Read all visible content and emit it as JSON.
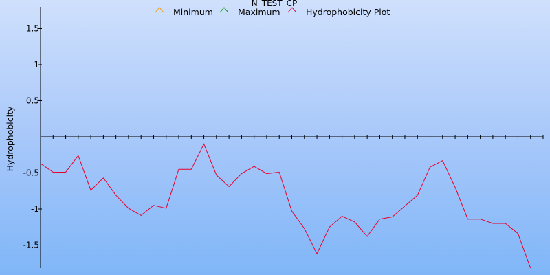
{
  "chart_data": {
    "type": "line",
    "title": "N_TEST_CP",
    "xlabel": "",
    "ylabel": "Hydrophobicity",
    "ylim": [
      -1.8,
      1.8
    ],
    "yticks": [
      1.5,
      1,
      0.5,
      -0.5,
      -1,
      -1.5
    ],
    "ytick_labels": [
      "1.5",
      "1",
      "0.5",
      "-0.5",
      "-1",
      "-1.5"
    ],
    "legend_position": "top-center",
    "x": [
      1,
      2,
      3,
      4,
      5,
      6,
      7,
      8,
      9,
      10,
      11,
      12,
      13,
      14,
      15,
      16,
      17,
      18,
      19,
      20,
      21,
      22,
      23,
      24,
      25,
      26,
      27,
      28,
      29,
      30,
      31,
      32,
      33,
      34,
      35,
      36,
      37,
      38,
      39,
      40,
      41
    ],
    "series": [
      {
        "name": "Minimum",
        "color": "#e8a020",
        "values": [
          0.3,
          0.3,
          0.3,
          0.3,
          0.3,
          0.3,
          0.3,
          0.3,
          0.3,
          0.3,
          0.3,
          0.3,
          0.3,
          0.3,
          0.3,
          0.3,
          0.3,
          0.3,
          0.3,
          0.3,
          0.3,
          0.3,
          0.3,
          0.3,
          0.3,
          0.3,
          0.3,
          0.3,
          0.3,
          0.3,
          0.3,
          0.3,
          0.3,
          0.3,
          0.3,
          0.3,
          0.3,
          0.3,
          0.3,
          0.3,
          0.3
        ]
      },
      {
        "name": "Maximum",
        "color": "#00a000",
        "values": []
      },
      {
        "name": "Hydrophobicity Plot",
        "color": "#e8002a",
        "values": [
          -0.37,
          -0.49,
          -0.49,
          -0.26,
          -0.74,
          -0.57,
          -0.81,
          -0.99,
          -1.09,
          -0.95,
          -0.99,
          -0.45,
          -0.45,
          -0.1,
          -0.53,
          -0.69,
          -0.51,
          -0.41,
          -0.51,
          -0.49,
          -1.03,
          -1.27,
          -1.62,
          -1.25,
          -1.1,
          -1.18,
          -1.38,
          -1.14,
          -1.11,
          -0.96,
          -0.81,
          -0.42,
          -0.33,
          -0.7,
          -1.14,
          -1.14,
          -1.2,
          -1.2,
          -1.34,
          -1.82
        ]
      }
    ]
  }
}
